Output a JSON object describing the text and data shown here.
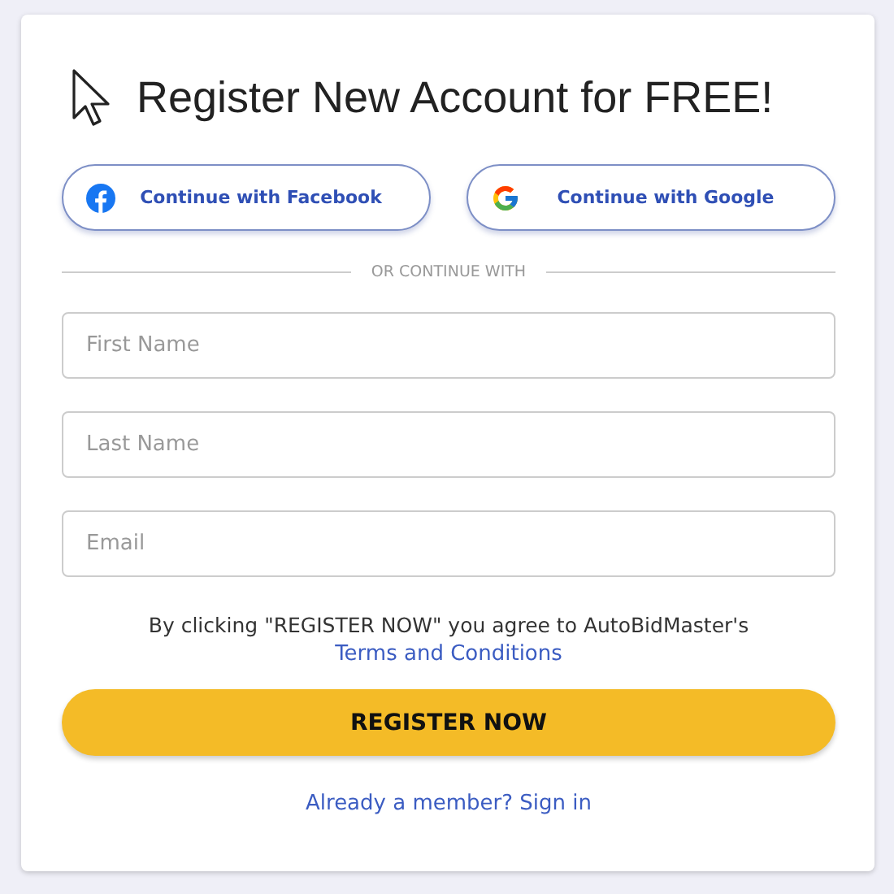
{
  "title": "Register New Account for FREE!",
  "social_buttons": [
    {
      "kind": "facebook",
      "label": "Continue with Facebook"
    },
    {
      "kind": "google",
      "label": "Continue with Google"
    }
  ],
  "divider": "OR CONTINUE WITH",
  "fields": [
    {
      "placeholder": "First Name"
    },
    {
      "placeholder": "Last Name"
    },
    {
      "placeholder": "Email"
    }
  ],
  "agreement": "By clicking \"REGISTER NOW\" you agree to AutoBidMaster's",
  "terms_link": "Terms and Conditions",
  "register_button": "REGISTER NOW",
  "signin_link": "Already a member? Sign in"
}
